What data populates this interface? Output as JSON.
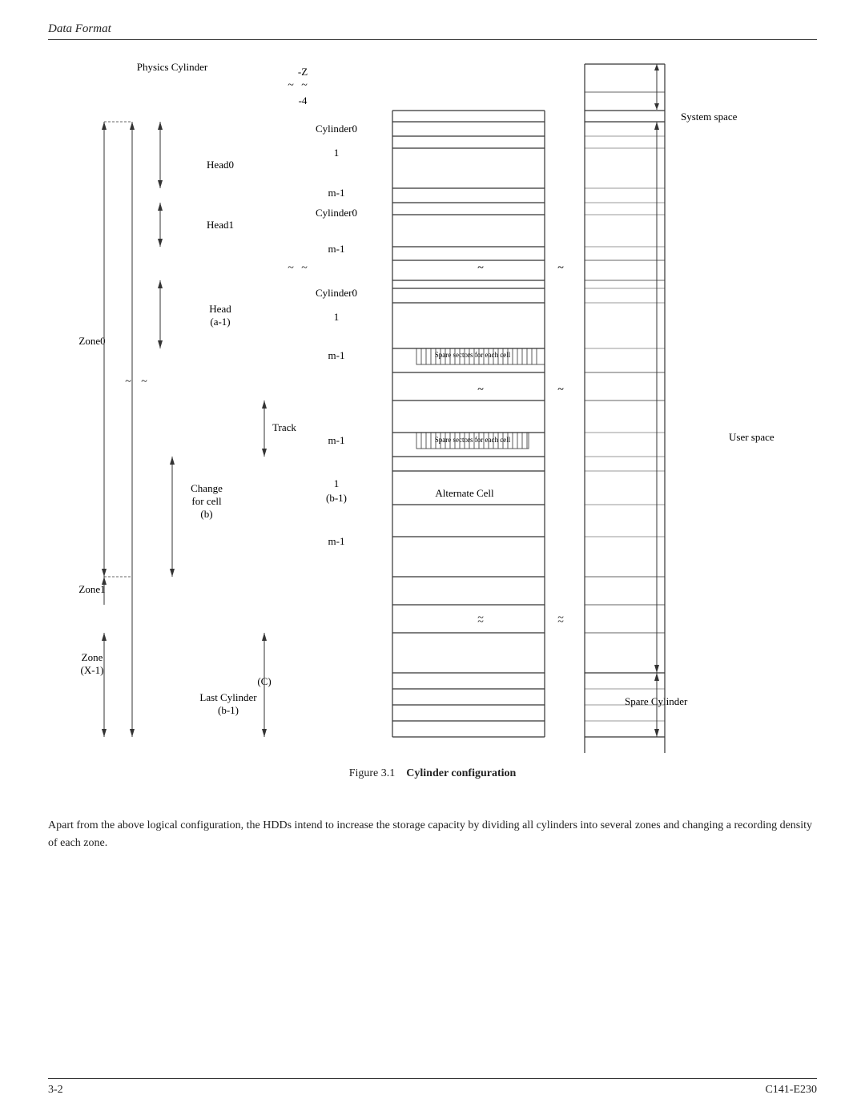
{
  "header": {
    "title": "Data Format"
  },
  "footer": {
    "left": "3-2",
    "right": "C141-E230"
  },
  "figure": {
    "number": "Figure 3.1",
    "caption": "Cylinder configuration"
  },
  "body_text": "Apart from the above logical configuration, the HDDs intend to increase the storage capacity by dividing all cylinders into several zones and changing a recording density of each zone.",
  "diagram": {
    "labels": {
      "physics_cylinder": "Physics Cylinder",
      "minus_z": "-Z",
      "minus_4": "-4",
      "system_space": "System space",
      "cylinder0_1": "Cylinder0",
      "one_1": "1",
      "head0": "Head0",
      "m1_1": "m-1",
      "cylinder0_2": "Cylinder0",
      "head1": "Head1",
      "m1_2": "m-1",
      "cylinder0_3": "Cylinder0",
      "head_a1": "Head",
      "head_a1b": "(a-1)",
      "one_3": "1",
      "zone0": "Zone0",
      "m1_3": "m-1",
      "spare1": "Spare sectors for each cell",
      "track_label": "Track",
      "m1_4": "m-1",
      "spare2": "Spare sectors for each cell",
      "change_cell": "Change",
      "for_cell": "for cell",
      "cell_b": "(b)",
      "one_b": "1",
      "b1": "(b-1)",
      "alternate_cell": "Alternate Cell",
      "m1_5": "m-1",
      "zone1": "Zone1",
      "zone_x1": "Zone",
      "zone_x1b": "(X-1)",
      "c_label": "(C)",
      "last_cylinder": "Last Cylinder",
      "last_b1": "(b-1)",
      "spare_cylinder": "Spare Cylinder",
      "user_space": "User space"
    }
  }
}
